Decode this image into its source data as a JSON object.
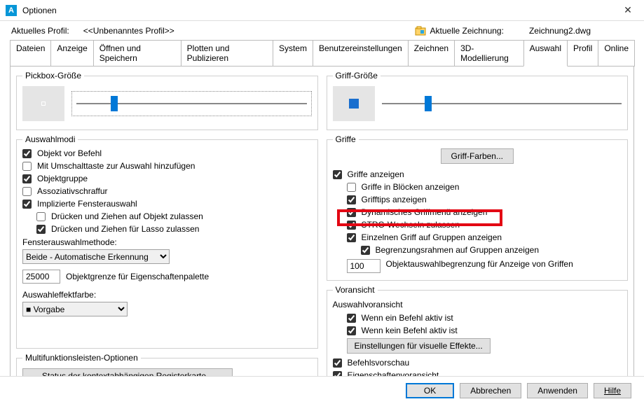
{
  "window": {
    "title": "Optionen",
    "close": "✕",
    "app_letter": "A"
  },
  "header": {
    "profile_label": "Aktuelles Profil:",
    "profile_value": "<<Unbenanntes Profil>>",
    "drawing_label": "Aktuelle Zeichnung:",
    "drawing_value": "Zeichnung2.dwg"
  },
  "tabs": {
    "t0": "Dateien",
    "t1": "Anzeige",
    "t2": "Öffnen und Speichern",
    "t3": "Plotten und Publizieren",
    "t4": "System",
    "t5": "Benutzereinstellungen",
    "t6": "Zeichnen",
    "t7": "3D-Modellierung",
    "t8": "Auswahl",
    "t9": "Profil",
    "t10": "Online"
  },
  "left": {
    "pickbox_legend": "Pickbox-Größe",
    "modi_legend": "Auswahlmodi",
    "chk_objekt_vor_befehl": "Objekt vor Befehl",
    "chk_umschalt": "Mit Umschalttaste zur Auswahl hinzufügen",
    "chk_objektgruppe": "Objektgruppe",
    "chk_assoz": "Assoziativschraffur",
    "chk_impl": "Implizierte Fensterauswahl",
    "chk_druecken_obj": "Drücken und Ziehen auf Objekt zulassen",
    "chk_druecken_lasso": "Drücken und Ziehen für Lasso zulassen",
    "fenstermethode_label": "Fensterauswahlmethode:",
    "fenstermethode_value": "Beide - Automatische Erkennung",
    "objektgrenze_value": "25000",
    "objektgrenze_label": "Objektgrenze für Eigenschaftenpalette",
    "effektfarbe_label": "Auswahleffektfarbe:",
    "effektfarbe_value": "Vorgabe",
    "multi_legend": "Multifunktionsleisten-Optionen",
    "multi_btn": "Status der kontextabhängigen Registerkarte..."
  },
  "right": {
    "griff_legend": "Griff-Größe",
    "griffe_legend": "Griffe",
    "griff_farben_btn": "Griff-Farben...",
    "chk_griffe_anz": "Griffe anzeigen",
    "chk_griffe_block": "Griffe in Blöcken anzeigen",
    "chk_grifftips": "Grifftips anzeigen",
    "chk_dyn_menu": "Dynamisches Griffmenü anzeigen",
    "chk_strg": "STRG-Wechseln zulassen",
    "chk_einzelgriff": "Einzelnen Griff auf Gruppen anzeigen",
    "chk_begrenz": "Begrenzungsrahmen auf Gruppen anzeigen",
    "griff_limit_value": "100",
    "griff_limit_label": "Objektauswahlbegrenzung für Anzeige von Griffen",
    "voransicht_legend": "Voransicht",
    "auswahlvor_label": "Auswahlvoransicht",
    "chk_wenn_aktiv": "Wenn ein Befehl aktiv ist",
    "chk_wenn_kein": "Wenn kein Befehl aktiv ist",
    "visuelle_btn": "Einstellungen für visuelle Effekte...",
    "chk_befehlsvor": "Befehlsvorschau",
    "chk_eigvor": "Eigenschaftenvoransicht"
  },
  "footer": {
    "ok": "OK",
    "cancel": "Abbrechen",
    "apply": "Anwenden",
    "help": "Hilfe"
  }
}
